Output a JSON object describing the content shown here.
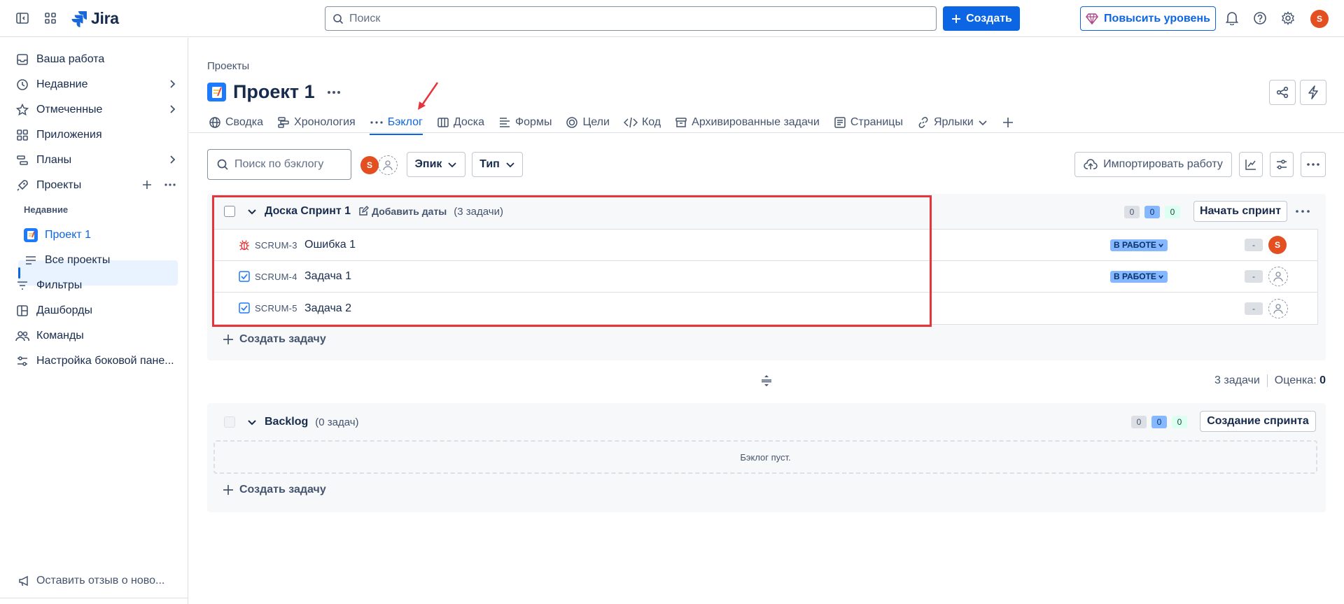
{
  "topbar": {
    "logo_text": "Jira",
    "search_placeholder": "Поиск",
    "create_label": "Создать",
    "upgrade_label": "Повысить уровень",
    "user_initial": "S"
  },
  "sidebar": {
    "items": [
      {
        "label": "Ваша работа"
      },
      {
        "label": "Недавние"
      },
      {
        "label": "Отмеченные"
      },
      {
        "label": "Приложения"
      },
      {
        "label": "Планы"
      },
      {
        "label": "Проекты"
      },
      {
        "label": "Фильтры"
      },
      {
        "label": "Дашборды"
      },
      {
        "label": "Команды"
      },
      {
        "label": "Настройка боковой пане..."
      }
    ],
    "recent_header": "Недавние",
    "project_item": "Проект 1",
    "all_projects": "Все проекты",
    "feedback": "Оставить отзыв о ново..."
  },
  "header": {
    "breadcrumb": "Проекты",
    "title": "Проект 1"
  },
  "tabs": [
    {
      "label": "Сводка",
      "icon": "globe-icon"
    },
    {
      "label": "Хронология",
      "icon": "timeline-icon"
    },
    {
      "label": "Бэклог",
      "icon": "more-icon",
      "active": true
    },
    {
      "label": "Доска",
      "icon": "board-icon"
    },
    {
      "label": "Формы",
      "icon": "forms-icon"
    },
    {
      "label": "Цели",
      "icon": "goals-icon"
    },
    {
      "label": "Код",
      "icon": "code-icon"
    },
    {
      "label": "Архивированные задачи",
      "icon": "archive-icon"
    },
    {
      "label": "Страницы",
      "icon": "pages-icon"
    },
    {
      "label": "Ярлыки",
      "icon": "link-icon"
    }
  ],
  "toolbar": {
    "search_placeholder": "Поиск по бэклогу",
    "epic_label": "Эпик",
    "type_label": "Тип",
    "import_label": "Импортировать работу",
    "avatar_initial": "S"
  },
  "sprint": {
    "name": "Доска Спринт 1",
    "add_dates": "Добавить даты",
    "count": "(3 задачи)",
    "pills": [
      "0",
      "0",
      "0"
    ],
    "start_label": "Начать спринт",
    "issues": [
      {
        "key": "SCRUM-3",
        "title": "Ошибка 1",
        "type": "bug",
        "status": "В РАБОТЕ",
        "estimate": "-",
        "assignee": "S"
      },
      {
        "key": "SCRUM-4",
        "title": "Задача 1",
        "type": "task",
        "status": "В РАБОТЕ",
        "estimate": "-",
        "assignee": ""
      },
      {
        "key": "SCRUM-5",
        "title": "Задача 2",
        "type": "task",
        "status": "",
        "estimate": "-",
        "assignee": ""
      }
    ],
    "create_task": "Создать задачу"
  },
  "summary": {
    "tasks": "3 задачи",
    "estimate_label": "Оценка:",
    "estimate_value": "0"
  },
  "backlog": {
    "name": "Backlog",
    "count": "(0 задач)",
    "pills": [
      "0",
      "0",
      "0"
    ],
    "create_sprint": "Создание спринта",
    "empty_text": "Бэклог пуст.",
    "create_task": "Создать задачу"
  },
  "colors": {
    "brand": "#0c66e4",
    "status_bg": "#85b8ff",
    "highlight": "#e5343a",
    "avatar": "#e34f21"
  }
}
